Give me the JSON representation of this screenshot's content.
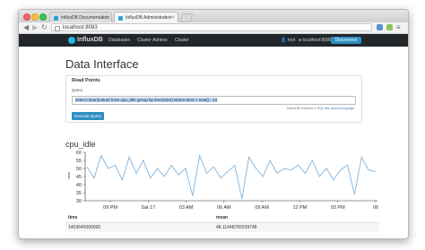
{
  "browser": {
    "tabs": [
      {
        "label": "InfluxDB Documentation"
      },
      {
        "label": "InfluxDB Administration"
      }
    ],
    "close_glyph": "×",
    "url": "localhost:8083",
    "nav": {
      "back": "◀",
      "forward": "▶",
      "reload": "↻"
    },
    "menu_glyph": "≡"
  },
  "app": {
    "logo_text": "InfluxDB",
    "nav": {
      "databases": "Databases",
      "cluster_admins": "Cluster Admins",
      "cluster": "Cluster"
    },
    "user": "root",
    "host": "localhost:8086",
    "disconnect_label": "Disconnect"
  },
  "page": {
    "title": "Data Interface",
    "read_points_title": "Read Points",
    "query_label": "Query",
    "query_value": "select mean(value) from cpu_idle group by time(30m) where time > now() - 1d",
    "helper_text": "InfluxDB features a",
    "helper_link": "SQL-like query language",
    "execute_label": "Execute Query"
  },
  "series": {
    "title": "cpu_idle",
    "columns": [
      "time",
      "mean"
    ],
    "rows": [
      [
        "1403640000000",
        "48.11448765539748"
      ]
    ]
  },
  "chart_data": {
    "type": "line",
    "title": "cpu_idle",
    "ylabel": "mean",
    "ylim": [
      30,
      60
    ],
    "yticks": [
      60,
      55,
      50,
      45,
      40,
      35,
      30
    ],
    "xticklabels": [
      "09 PM",
      "Sat 17",
      "03 AM",
      "06 AM",
      "09 AM",
      "12 PM",
      "03 PM",
      "06"
    ],
    "values": [
      51,
      44,
      58,
      50,
      52,
      43,
      57,
      47,
      55,
      44,
      50,
      45,
      52,
      46,
      50,
      33,
      58,
      47,
      51,
      44,
      48,
      52,
      31,
      57,
      50,
      45,
      55,
      47,
      50,
      49,
      52,
      47,
      55,
      45,
      50,
      43,
      49,
      52,
      34,
      57,
      49,
      48
    ],
    "line_color": "#7fb3dd",
    "grid": false,
    "legend": "none"
  },
  "colors": {
    "accent": "#2d8fc1",
    "topnav_bg": "#23262a",
    "logo": "#1fb6e9"
  }
}
